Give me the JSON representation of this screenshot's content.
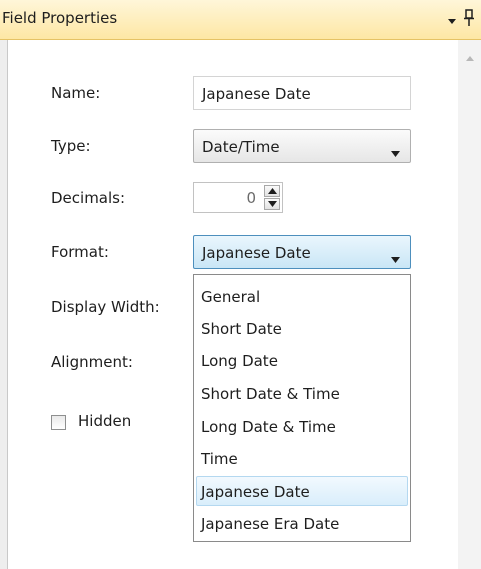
{
  "panel": {
    "title": "Field Properties"
  },
  "form": {
    "name_label": "Name:",
    "name_value": "Japanese Date",
    "type_label": "Type:",
    "type_value": "Date/Time",
    "decimals_label": "Decimals:",
    "decimals_value": "0",
    "format_label": "Format:",
    "format_value": "Japanese Date",
    "display_width_label": "Display Width:",
    "alignment_label": "Alignment:",
    "hidden_label": "Hidden",
    "hidden_checked": false
  },
  "format_options": {
    "items": [
      "General",
      "Short Date",
      "Long Date",
      "Short Date & Time",
      "Long Date & Time",
      "Time",
      "Japanese Date",
      "Japanese Era Date"
    ],
    "highlighted": "Japanese Date"
  },
  "icons": {
    "panel_menu": "dropdown-arrow-icon",
    "pin": "pin-icon",
    "scroll_up": "scroll-up-icon",
    "combo_arrow": "chevron-down-icon",
    "spinner_up": "spin-up-icon",
    "spinner_down": "spin-down-icon"
  },
  "colors": {
    "titlebar": "#fde7a4",
    "selection": "#d9eefb",
    "active_border": "#4d8fbd"
  }
}
